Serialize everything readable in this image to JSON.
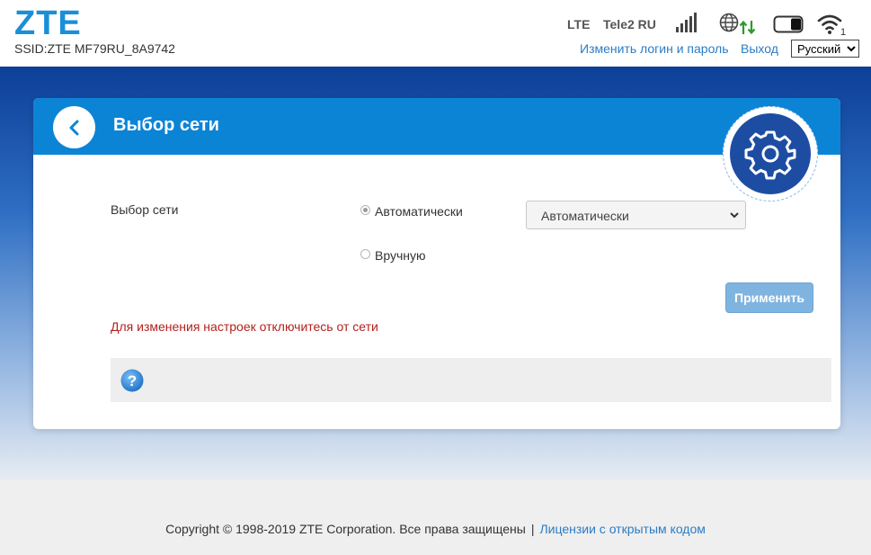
{
  "header": {
    "logo": "ZTE",
    "ssid": "SSID:ZTE MF79RU_8A9742",
    "network_type": "LTE",
    "operator": "Tele2 RU",
    "wifi_clients": "1",
    "change_login_link": "Изменить логин и пароль",
    "logout_link": "Выход",
    "language": "Русский"
  },
  "panel": {
    "title": "Выбор сети",
    "field_label": "Выбор сети",
    "radio_auto": "Автоматически",
    "radio_manual": "Вручную",
    "select_value": "Автоматически",
    "apply_button": "Применить",
    "warning": "Для изменения настроек отключитесь от сети"
  },
  "footer": {
    "copyright": "Copyright © 1998-2019 ZTE Corporation. Все права защищены",
    "separator": "|",
    "license_link": "Лицензии с открытым кодом"
  },
  "colors": {
    "accent": "#0c84d6",
    "brand": "#1a8fd8",
    "warning": "#b2221e",
    "link": "#2b7cc4"
  }
}
